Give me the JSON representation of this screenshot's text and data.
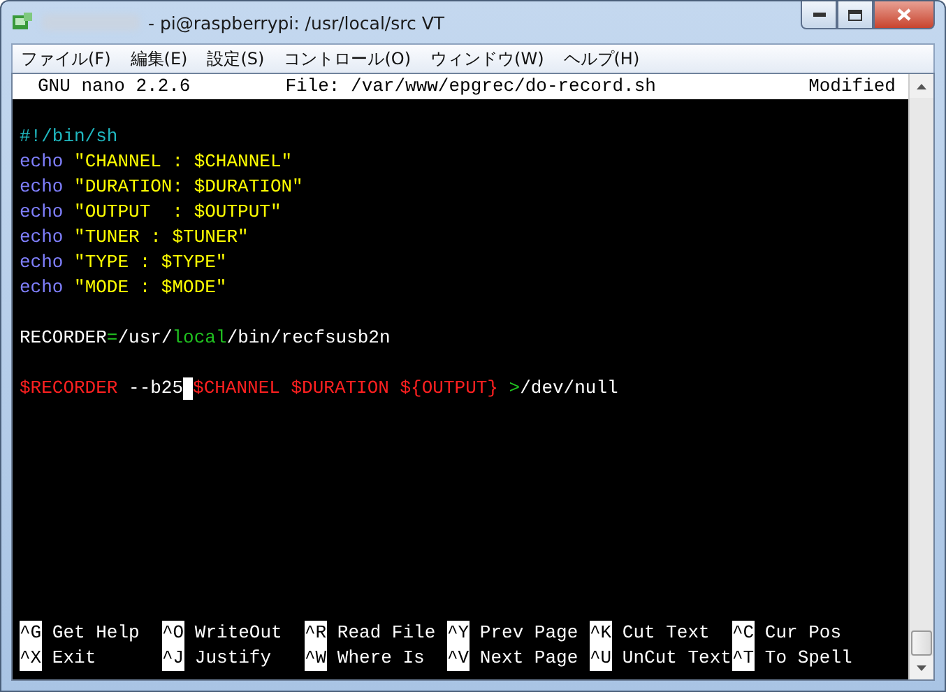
{
  "window": {
    "title": "- pi@raspberrypi: /usr/local/src VT"
  },
  "menu": [
    "ファイル(F)",
    "編集(E)",
    "設定(S)",
    "コントロール(O)",
    "ウィンドウ(W)",
    "ヘルプ(H)"
  ],
  "nano_header": {
    "version": "GNU nano 2.2.6",
    "file": "File: /var/www/epgrec/do-record.sh",
    "status": "Modified"
  },
  "lines": [
    {
      "kind": "blank"
    },
    {
      "kind": "code",
      "segments": [
        {
          "kind": "comment",
          "text": "#!/bin/sh"
        }
      ]
    },
    {
      "kind": "code",
      "segments": [
        {
          "kind": "keyword",
          "text": "echo"
        },
        {
          "kind": "string",
          "text": " \"CHANNEL : $CHANNEL\""
        }
      ]
    },
    {
      "kind": "code",
      "segments": [
        {
          "kind": "keyword",
          "text": "echo"
        },
        {
          "kind": "string",
          "text": " \"DURATION: $DURATION\""
        }
      ]
    },
    {
      "kind": "code",
      "segments": [
        {
          "kind": "keyword",
          "text": "echo"
        },
        {
          "kind": "string",
          "text": " \"OUTPUT  : $OUTPUT\""
        }
      ]
    },
    {
      "kind": "code",
      "segments": [
        {
          "kind": "keyword",
          "text": "echo"
        },
        {
          "kind": "string",
          "text": " \"TUNER : $TUNER\""
        }
      ]
    },
    {
      "kind": "code",
      "segments": [
        {
          "kind": "keyword",
          "text": "echo"
        },
        {
          "kind": "string",
          "text": " \"TYPE : $TYPE\""
        }
      ]
    },
    {
      "kind": "code",
      "segments": [
        {
          "kind": "keyword",
          "text": "echo"
        },
        {
          "kind": "string",
          "text": " \"MODE : $MODE\""
        }
      ]
    },
    {
      "kind": "blank"
    },
    {
      "kind": "code",
      "segments": [
        {
          "kind": "plain",
          "text": "RECORDER"
        },
        {
          "kind": "symbol",
          "text": "="
        },
        {
          "kind": "plain",
          "text": "/usr/"
        },
        {
          "kind": "symbol",
          "text": "local"
        },
        {
          "kind": "plain",
          "text": "/bin/recfsusb2n"
        }
      ]
    },
    {
      "kind": "blank"
    },
    {
      "kind": "code",
      "segments": [
        {
          "kind": "variable",
          "text": "$RECORDER"
        },
        {
          "kind": "plain",
          "text": " --b25"
        },
        {
          "kind": "cursor"
        },
        {
          "kind": "variable",
          "text": "$CHANNEL $DURATION ${OUTPUT} "
        },
        {
          "kind": "symbol",
          "text": ">"
        },
        {
          "kind": "plain",
          "text": "/dev/null"
        }
      ]
    }
  ],
  "shortcut_rows": [
    [
      {
        "key": "^G",
        "label": "Get Help"
      },
      {
        "key": "^O",
        "label": "WriteOut"
      },
      {
        "key": "^R",
        "label": "Read File"
      },
      {
        "key": "^Y",
        "label": "Prev Page"
      },
      {
        "key": "^K",
        "label": "Cut Text"
      },
      {
        "key": "^C",
        "label": "Cur Pos"
      }
    ],
    [
      {
        "key": "^X",
        "label": "Exit"
      },
      {
        "key": "^J",
        "label": "Justify"
      },
      {
        "key": "^W",
        "label": "Where Is"
      },
      {
        "key": "^V",
        "label": "Next Page"
      },
      {
        "key": "^U",
        "label": "UnCut Text"
      },
      {
        "key": "^T",
        "label": "To Spell"
      }
    ]
  ]
}
